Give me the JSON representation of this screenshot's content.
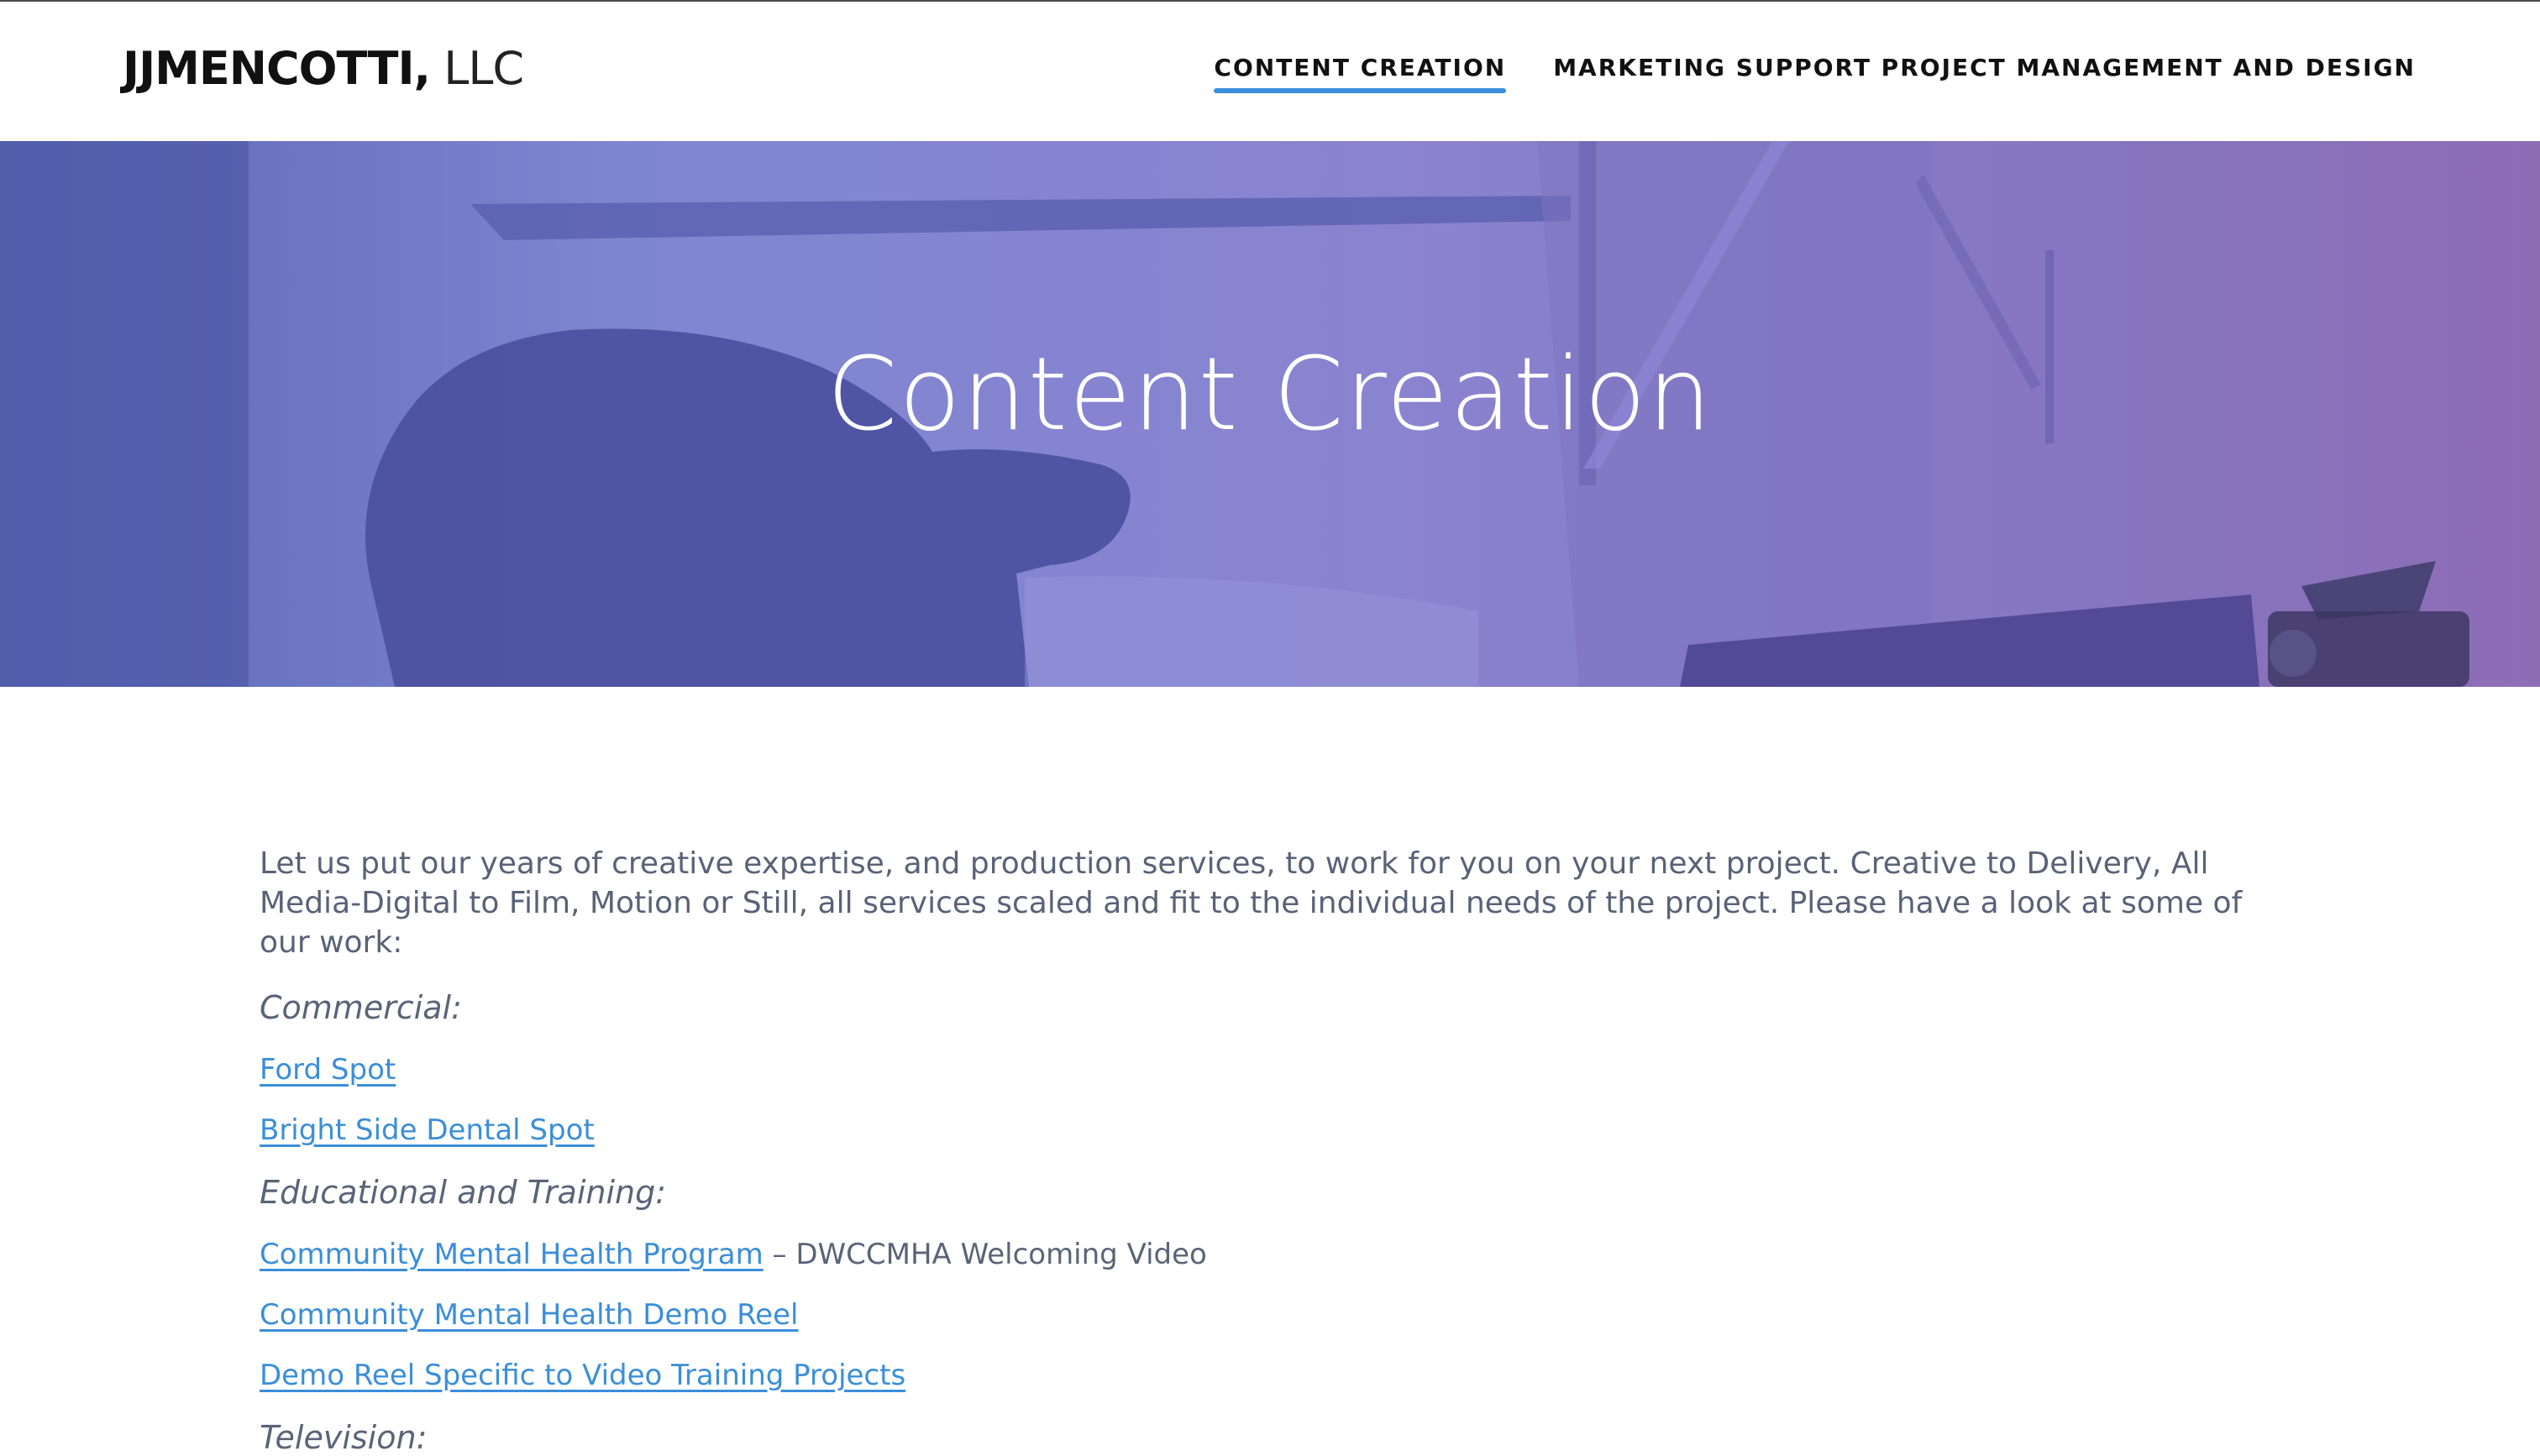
{
  "site": {
    "logo_bold": "JJMENCOTTI,",
    "logo_light": " LLC"
  },
  "nav": {
    "items": [
      {
        "label": "CONTENT CREATION",
        "active": true
      },
      {
        "label": "MARKETING SUPPORT PROJECT MANAGEMENT AND DESIGN",
        "active": false
      }
    ]
  },
  "hero": {
    "title": "Content Creation"
  },
  "content": {
    "intro": "Let us put our years of creative expertise, and production services, to work for you on your next project.  Creative to Delivery, All Media-Digital to Film, Motion or Still, all services scaled and fit to the individual needs of the project.  Please have a look at some of our work:",
    "commercial_heading": "Commercial:",
    "ford_link": "Ford Spot",
    "dental_link": "Bright Side Dental Spot",
    "education_heading": "Educational and Training:",
    "cmh_program_link": "Community Mental Health Program",
    "cmh_program_suffix": " – DWCCMHA Welcoming Video",
    "cmh_demo_link": "Community Mental Health Demo Reel",
    "training_demo_link": "Demo Reel Specific to Video Training Projects",
    "television_heading": "Television:"
  },
  "colors": {
    "accent": "#3d8fde",
    "link": "#3b8ed9",
    "hero_overlay_left": "#5c67b9",
    "hero_overlay_right": "#8e6db5",
    "body_text": "#5a6477"
  }
}
